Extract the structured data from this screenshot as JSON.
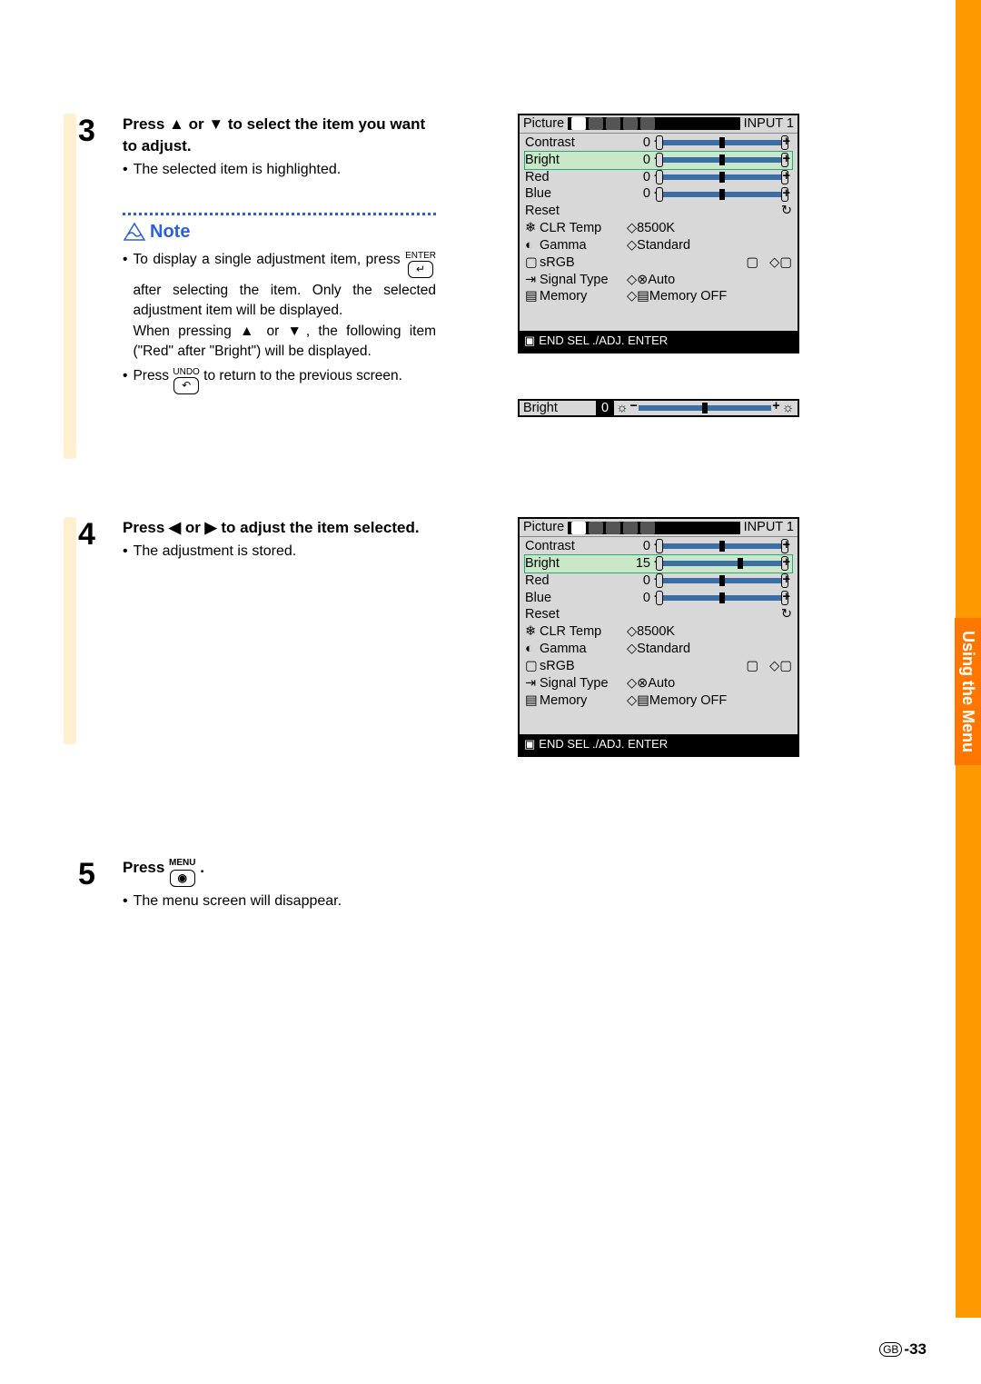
{
  "sideTab": "Using the Menu",
  "pageNum": {
    "gb": "GB",
    "num": "-33"
  },
  "steps": {
    "s3": {
      "num": "3",
      "title_a": "Press ▲ or ▼ to select the item you want to adjust.",
      "detail": "The selected item is highlighted.",
      "note_label": "Note",
      "note1a": "To display a single adjustment item, press ",
      "note1_key": "↵",
      "note1_keylabel": "ENTER",
      "note1b": " after selecting the item. Only the selected adjustment item will be displayed.",
      "note1c": "When pressing ▲ or ▼, the following item (\"Red\" after \"Bright\") will be displayed.",
      "note2a": "Press ",
      "note2_key": "↶",
      "note2_keylabel": "UNDO",
      "note2b": " to return to the previous screen."
    },
    "s4": {
      "num": "4",
      "title": "Press ◀ or ▶ to adjust the item selected.",
      "detail": "The adjustment is stored."
    },
    "s5": {
      "num": "5",
      "title_a": "Press ",
      "title_key": "◉",
      "title_keylabel": "MENU",
      "title_b": ".",
      "detail": "The menu screen will disappear."
    }
  },
  "osd": {
    "picture": "Picture",
    "input": "INPUT 1",
    "rows": {
      "contrast": "Contrast",
      "bright": "Bright",
      "red": "Red",
      "blue": "Blue",
      "reset": "Reset",
      "clrtemp": "CLR Temp",
      "gamma": "Gamma",
      "srgb": "sRGB",
      "signal": "Signal Type",
      "memory": "Memory"
    },
    "vals": {
      "contrast": "0",
      "bright0": "0",
      "bright15": "15",
      "red": "0",
      "blue": "0",
      "clrtemp": "8500K",
      "gamma": "Standard",
      "signal": "Auto",
      "memory": "Memory OFF"
    },
    "footer": "END     SEL ./ADJ.   ENTER",
    "singleBright": "Bright",
    "singleBrightVal": "0"
  }
}
